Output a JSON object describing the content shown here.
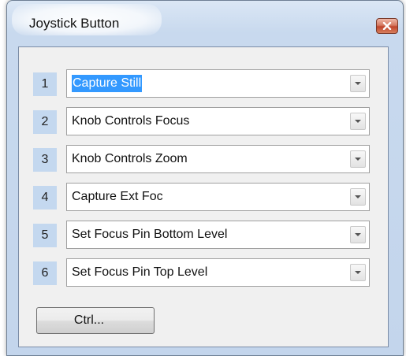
{
  "window": {
    "title": "Joystick Button",
    "close_icon": "close-icon"
  },
  "rows": [
    {
      "number": "1",
      "value": "Capture Still",
      "selected": true
    },
    {
      "number": "2",
      "value": "Knob Controls Focus",
      "selected": false
    },
    {
      "number": "3",
      "value": "Knob Controls Zoom",
      "selected": false
    },
    {
      "number": "4",
      "value": "Capture Ext Foc",
      "selected": false
    },
    {
      "number": "5",
      "value": "Set Focus Pin Bottom Level",
      "selected": false
    },
    {
      "number": "6",
      "value": "Set Focus Pin Top Level",
      "selected": false
    }
  ],
  "ctrl_button": {
    "label": "Ctrl..."
  },
  "colors": {
    "number_box": "#c4d8ef",
    "selection": "#3399ff",
    "close_button": "#c0452c"
  }
}
